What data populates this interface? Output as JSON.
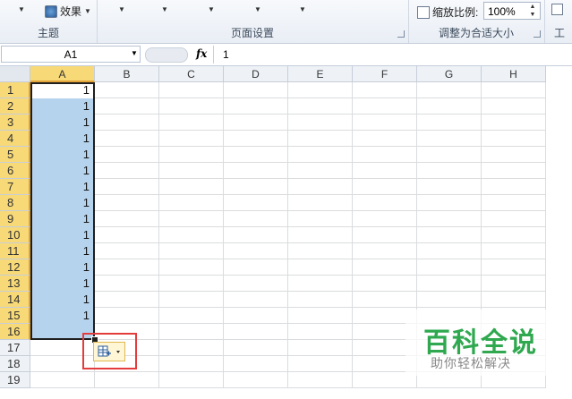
{
  "ribbon": {
    "effects_label": "效果",
    "group_theme": "主题",
    "group_page_setup": "页面设置",
    "zoom_label": "缩放比例:",
    "zoom_value": "100%",
    "group_scale_to_fit": "调整为合适大小",
    "right_partial": "工"
  },
  "formula_bar": {
    "name_box": "A1",
    "fx_label": "fx",
    "value": "1"
  },
  "sheet": {
    "columns": [
      "A",
      "B",
      "C",
      "D",
      "E",
      "F",
      "G",
      "H"
    ],
    "rows": [
      "1",
      "2",
      "3",
      "4",
      "5",
      "6",
      "7",
      "8",
      "9",
      "10",
      "11",
      "12",
      "13",
      "14",
      "15",
      "16",
      "17",
      "18",
      "19"
    ],
    "values": [
      "1",
      "1",
      "1",
      "1",
      "1",
      "1",
      "1",
      "1",
      "1",
      "1",
      "1",
      "1",
      "1",
      "1",
      "1"
    ]
  },
  "watermark": {
    "title": "百科全说",
    "subtitle": "助你轻松解决"
  },
  "colors": {
    "selection": "#b6d3ee",
    "header_selected": "#f7d977",
    "highlight_box": "#e43c3c"
  }
}
